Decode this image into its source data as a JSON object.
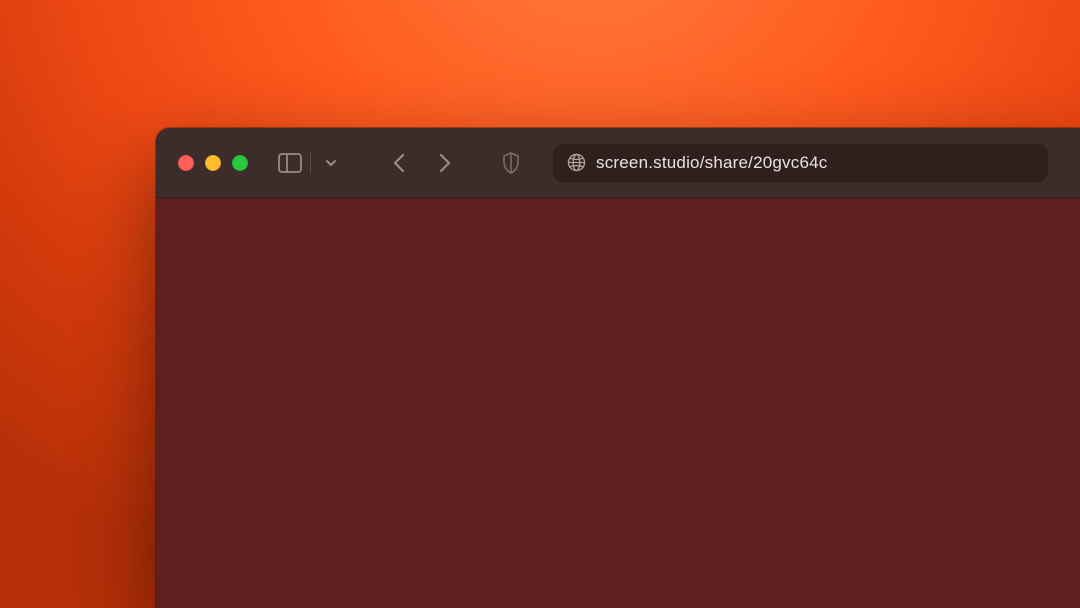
{
  "address_bar": {
    "url": "screen.studio/share/20gvc64c"
  },
  "colors": {
    "desktop_gradient_inner": "#ff7a3a",
    "desktop_gradient_outer": "#b52f08",
    "window_chrome": "#3d2d2a",
    "address_bar_bg": "#2f201e",
    "content_bg": "#5e1f1f",
    "traffic_red": "#ff5f57",
    "traffic_yellow": "#febc2e",
    "traffic_green": "#28c840"
  }
}
